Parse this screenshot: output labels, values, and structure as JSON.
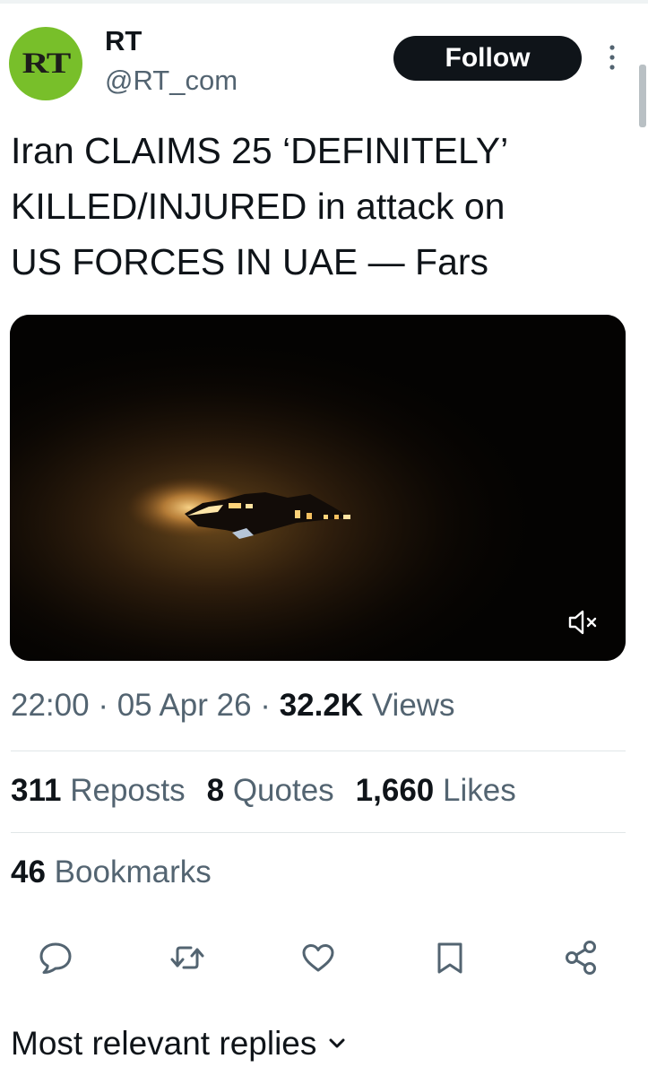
{
  "account": {
    "avatar_text": "RT",
    "name": "RT",
    "handle": "@RT_com"
  },
  "follow_button_label": "Follow",
  "tweet": {
    "text_lines": [
      "Iran CLAIMS 25 ‘DEFINITELY’",
      "KILLED/INJURED in attack on",
      "US FORCES IN UAE — Fars"
    ]
  },
  "media": {
    "type": "video",
    "mute_icon": "speaker-muted-icon"
  },
  "meta": {
    "time": "22:00",
    "separator": "·",
    "date": "05 Apr 26",
    "views_count": "32.2K",
    "views_label": "Views"
  },
  "stats": [
    {
      "count": "311",
      "label": "Reposts"
    },
    {
      "count": "8",
      "label": "Quotes"
    },
    {
      "count": "1,660",
      "label": "Likes"
    }
  ],
  "bookmarks": {
    "count": "46",
    "label": "Bookmarks"
  },
  "actions": [
    "reply-icon",
    "repost-icon",
    "like-icon",
    "bookmark-icon",
    "share-icon"
  ],
  "replies_sort": {
    "label": "Most relevant replies"
  },
  "colors": {
    "text": "#0f1419",
    "secondary_text": "#536471",
    "avatar_bg": "#78bf2a",
    "follow_bg": "#0f1419"
  }
}
